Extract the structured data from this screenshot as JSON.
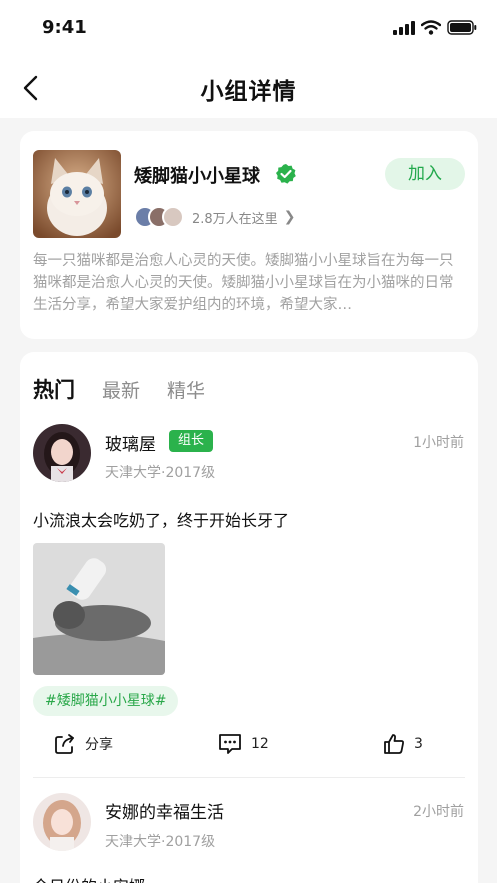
{
  "status_bar": {
    "time": "9:41"
  },
  "nav": {
    "title": "小组详情"
  },
  "group": {
    "name": "矮脚猫小小星球",
    "join_label": "加入",
    "member_count": "2.8万人在这里",
    "description": "每一只猫咪都是治愈人心灵的天使。矮脚猫小小星球旨在为每一只猫咪都是治愈人心灵的天使。矮脚猫小小星球旨在为小猫咪的日常生活分享，希望大家爱护组内的环境，希望大家…"
  },
  "tabs": [
    {
      "label": "热门",
      "active": true
    },
    {
      "label": "最新",
      "active": false
    },
    {
      "label": "精华",
      "active": false
    }
  ],
  "posts": [
    {
      "author": "玻璃屋",
      "badge": "组长",
      "meta": "天津大学·2017级",
      "time": "1小时前",
      "text": "小流浪太会吃奶了，终于开始长牙了",
      "tag": "#矮脚猫小小星球#",
      "share_label": "分享",
      "comments": "12",
      "likes": "3"
    },
    {
      "author": "安娜的幸福生活",
      "meta": "天津大学·2017级",
      "time": "2小时前",
      "text": "今日份的小安娜"
    }
  ],
  "colors": {
    "accent": "#2bb24c",
    "accent_light": "#e3f6e8",
    "background": "#f5f5f5"
  },
  "icons": [
    "back-arrow-icon",
    "signal-icon",
    "wifi-icon",
    "battery-icon",
    "verified-check-icon",
    "chevron-right-icon",
    "share-icon",
    "comment-icon",
    "thumbs-up-icon"
  ]
}
